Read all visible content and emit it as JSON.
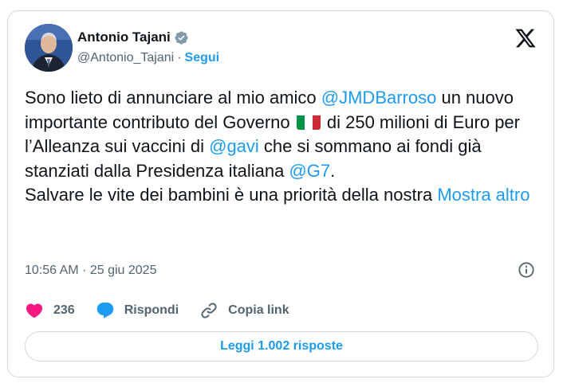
{
  "author": {
    "name": "Antonio Tajani",
    "handle": "@Antonio_Tajani",
    "separator": "·",
    "follow_label": "Segui",
    "avatar_icon": "avatar-photo",
    "verified_icon": "verified-badge-icon"
  },
  "platform_icon": "x-logo-icon",
  "tweet": {
    "part1": "Sono lieto di annunciare al mio amico ",
    "mention1": "@JMDBarroso",
    "part2": " un nuovo importante contributo del Governo ",
    "flag_icon": "italy-flag-icon",
    "part3": " di 250 milioni di Euro per l’Alleanza sui vaccini di ",
    "mention2": "@gavi",
    "part4": " che si sommano ai fondi già stanziati dalla Presidenza italiana ",
    "mention3": "@G7",
    "part5": ".",
    "line2": "Salvare le vite dei bambini è una priorità della nostra",
    "show_more": "Mostra altro"
  },
  "meta": {
    "time": "10:56 AM",
    "separator": "·",
    "date": "25 giu 2025"
  },
  "actions": {
    "likes_count": "236",
    "reply_label": "Rispondi",
    "copy_link_label": "Copia link"
  },
  "read_replies_label": "Leggi 1.002 risposte",
  "colors": {
    "accent": "#1d9bf0",
    "like": "#f91880",
    "text": "#0f1419",
    "muted": "#536471",
    "border": "#cfd9de"
  }
}
